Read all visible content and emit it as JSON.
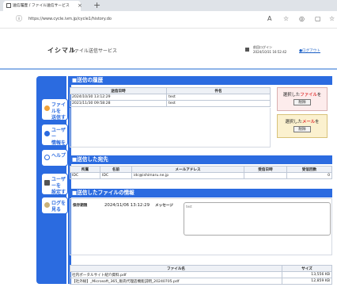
{
  "browser": {
    "tab_title": "送信履歴 / ファイル送信サービス",
    "tab_close": "×",
    "new_tab": "+",
    "url": "https://www.cycle.ivm.jp/cycle1/history.do",
    "icons": [
      "translate-icon",
      "star-icon",
      "profile-icon",
      "extensions-icon",
      "bookmark-icon"
    ]
  },
  "header": {
    "logo": "イシマル",
    "service_name": "ファイル送信サービス",
    "last_login_label": "前回ログイン",
    "last_login_time": "2024/10/31 16:52:42",
    "logout": "ログアウト"
  },
  "sidebar": {
    "items": [
      {
        "label": "ファイルを\n送信する",
        "icon": "send-icon"
      },
      {
        "label": "ユーザー\n情報を見る",
        "icon": "info-icon"
      },
      {
        "label": "ヘルプ",
        "icon": "help-icon"
      },
      {
        "label": "ユーザーを\n設定する",
        "icon": "user-settings-icon"
      },
      {
        "label": "ログを見る",
        "icon": "log-icon"
      }
    ]
  },
  "history": {
    "title": "■送信の履歴",
    "columns": [
      "送信日時",
      "件名"
    ],
    "rows": [
      [
        "2024/10/30 13:12:29",
        "test"
      ],
      [
        "2021/11/30 09:58:28",
        "test"
      ]
    ],
    "file_box": {
      "prefix": "選択した",
      "highlight": "ファイル",
      "suffix": "を",
      "button": "削除"
    },
    "mail_box": {
      "prefix": "選択した",
      "highlight": "メール",
      "suffix": "を",
      "button": "削除"
    }
  },
  "recipients": {
    "title": "■送信した宛先",
    "columns": [
      "所属",
      "名前",
      "メールアドレス",
      "受信日時",
      "受信回数"
    ],
    "rows": [
      [
        "IDC",
        "IDC",
        "idc@ishimaru.ne.jp",
        "",
        "0"
      ]
    ]
  },
  "files": {
    "title": "■送信したファイルの情報",
    "expiry_label": "保存期限",
    "expiry_value": "2024/11/06 13:12:29",
    "message_label": "メッセージ",
    "message_value": "test",
    "columns": [
      "ファイル名",
      "サイズ"
    ],
    "rows": [
      [
        "社内ポータルサイト紹介資料.pdf",
        "13,556 KB"
      ],
      [
        "【社外秘】_Microsoft_365_販売代理店機能説明_20240705.pdf",
        "12,859 KB"
      ]
    ]
  }
}
